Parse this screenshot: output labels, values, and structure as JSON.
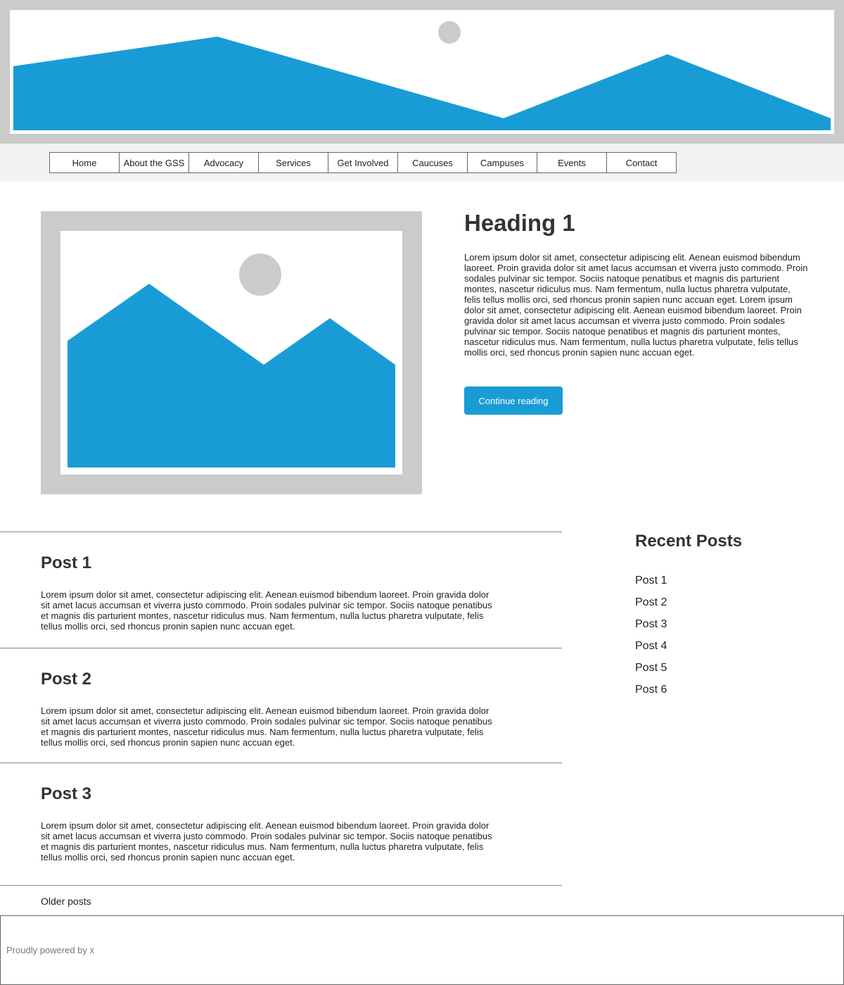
{
  "colors": {
    "accent": "#199cd6",
    "placeholder_gray": "#cbcbcb",
    "nav_background": "#f2f2f2"
  },
  "header": {
    "banner_icon": "image-placeholder-icon"
  },
  "nav": {
    "items": [
      "Home",
      "About the GSS",
      "Advocacy",
      "Services",
      "Get Involved",
      "Caucuses",
      "Campuses",
      "Events",
      "Contact"
    ]
  },
  "featured": {
    "image_icon": "image-placeholder-icon",
    "heading": "Heading 1",
    "body": "Lorem ipsum dolor sit amet, consectetur adipiscing elit. Aenean euismod bibendum laoreet. Proin gravida dolor sit amet lacus accumsan et viverra justo commodo. Proin sodales pulvinar sic tempor. Sociis natoque penatibus et magnis dis parturient montes, nascetur ridiculus mus. Nam fermentum, nulla luctus pharetra vulputate, felis tellus mollis orci, sed rhoncus pronin sapien nunc accuan eget. Lorem ipsum dolor sit amet, consectetur adipiscing elit. Aenean euismod bibendum laoreet. Proin gravida dolor sit amet lacus accumsan et viverra justo commodo. Proin sodales pulvinar sic tempor. Sociis natoque penatibus et magnis dis parturient montes, nascetur ridiculus mus. Nam fermentum, nulla luctus pharetra vulputate, felis tellus mollis orci, sed rhoncus pronin sapien nunc accuan eget.",
    "button_label": "Continue reading"
  },
  "posts": [
    {
      "title": "Post 1",
      "excerpt": "Lorem ipsum dolor sit amet, consectetur adipiscing elit. Aenean euismod bibendum laoreet. Proin gravida dolor sit amet lacus accumsan et viverra justo commodo. Proin sodales pulvinar sic tempor. Sociis natoque penatibus et magnis dis parturient montes, nascetur ridiculus mus. Nam fermentum, nulla luctus pharetra vulputate, felis tellus mollis orci, sed rhoncus pronin sapien nunc accuan eget."
    },
    {
      "title": "Post 2",
      "excerpt": "Lorem ipsum dolor sit amet, consectetur adipiscing elit. Aenean euismod bibendum laoreet. Proin gravida dolor sit amet lacus accumsan et viverra justo commodo. Proin sodales pulvinar sic tempor. Sociis natoque penatibus et magnis dis parturient montes, nascetur ridiculus mus. Nam fermentum, nulla luctus pharetra vulputate, felis tellus mollis orci, sed rhoncus pronin sapien nunc accuan eget."
    },
    {
      "title": "Post 3",
      "excerpt": "Lorem ipsum dolor sit amet, consectetur adipiscing elit. Aenean euismod bibendum laoreet. Proin gravida dolor sit amet lacus accumsan et viverra justo commodo. Proin sodales pulvinar sic tempor. Sociis natoque penatibus et magnis dis parturient montes, nascetur ridiculus mus. Nam fermentum, nulla luctus pharetra vulputate, felis tellus mollis orci, sed rhoncus pronin sapien nunc accuan eget."
    }
  ],
  "older_posts_label": "Older posts",
  "sidebar": {
    "title": "Recent Posts",
    "items": [
      "Post 1",
      "Post 2",
      "Post 3",
      "Post 4",
      "Post 5",
      "Post 6"
    ]
  },
  "footer": {
    "text": "Proudly powered by x"
  }
}
